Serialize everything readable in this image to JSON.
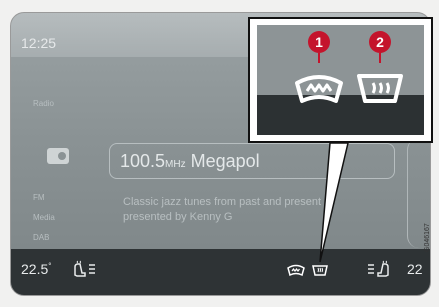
{
  "status_bar": {
    "time": "12:25"
  },
  "radio": {
    "frequency": "100.5",
    "unit": "MHz",
    "station": "Megapol",
    "description": "Classic jazz tunes from past and present presented by Kenny G"
  },
  "side_menu": [
    "Radio",
    "FM",
    "Media",
    "DAB"
  ],
  "climate": {
    "temp_left": "22.5",
    "temp_right": "22",
    "degree_symbol": "°"
  },
  "callouts": {
    "front_defrost_number": "1",
    "rear_defrost_number": "2"
  },
  "figure_code": "G046167",
  "colors": {
    "callout_red": "#c4142c",
    "bar_dark": "#2e3335",
    "screen_gray": "#8a9294"
  },
  "icons": [
    "windshield-defrost-icon",
    "rear-window-defrost-icon",
    "seat-heater-icon"
  ]
}
